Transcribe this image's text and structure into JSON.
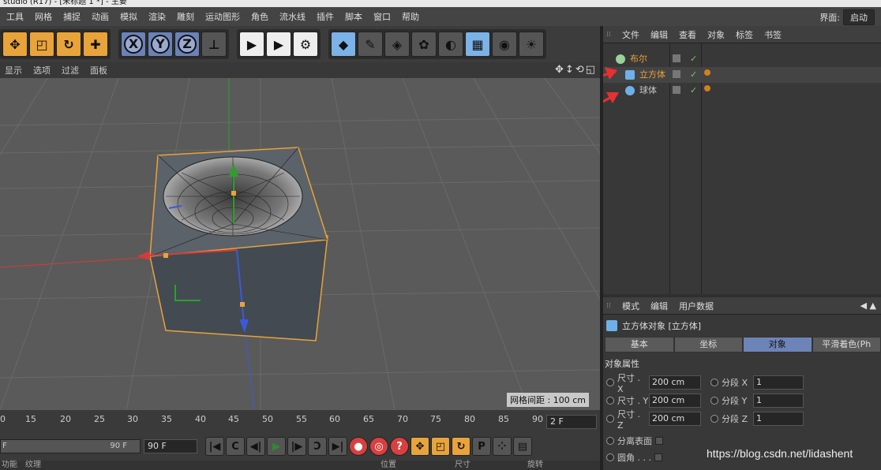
{
  "window": {
    "title": "studio (R17) - [未标题 1 *] - 主要"
  },
  "menubar": {
    "items": [
      "工具",
      "网格",
      "捕捉",
      "动画",
      "模拟",
      "渲染",
      "雕刻",
      "运动图形",
      "角色",
      "流水线",
      "插件",
      "脚本",
      "窗口",
      "帮助"
    ],
    "layout_label": "界面:",
    "layout_value": "启动"
  },
  "viewport": {
    "menu": [
      "显示",
      "选项",
      "过滤",
      "面板"
    ],
    "grid_spacing": "网格间距 : 100 cm"
  },
  "timeline": {
    "ticks": [
      "0",
      "15",
      "20",
      "25",
      "30",
      "35",
      "40",
      "45",
      "50",
      "55",
      "60",
      "65",
      "70",
      "75",
      "80",
      "85",
      "90"
    ],
    "current_frame": "2 F"
  },
  "transport": {
    "slider_start": "F",
    "slider_end": "90 F",
    "end_field": "90 F"
  },
  "bottom": {
    "labels": [
      "功能",
      "纹理",
      "位置",
      "尺寸",
      "旋转"
    ]
  },
  "object_manager": {
    "menu": [
      "文件",
      "编辑",
      "查看",
      "对象",
      "标签",
      "书签"
    ],
    "objects": [
      {
        "name": "布尔",
        "color": "#e8a33a"
      },
      {
        "name": "立方体",
        "color": "#e8a33a"
      },
      {
        "name": "球体",
        "color": "#c8c8c8"
      }
    ]
  },
  "attributes": {
    "menu": [
      "模式",
      "编辑",
      "用户数据"
    ],
    "object_title": "立方体对象 [立方体]",
    "tabs": [
      "基本",
      "坐标",
      "对象",
      "平滑着色(Ph"
    ],
    "active_tab": "对象",
    "section": "对象属性",
    "size_labels": [
      "尺寸 . X",
      "尺寸 . Y",
      "尺寸 . Z"
    ],
    "size_values": [
      "200 cm",
      "200 cm",
      "200 cm"
    ],
    "segment_labels": [
      "分段 X",
      "分段 Y",
      "分段 Z"
    ],
    "segment_values": [
      "1",
      "1",
      "1"
    ],
    "separate_surfaces": "分离表面",
    "fillet": "圆角 . . ."
  },
  "watermark": "https://blog.csdn.net/lidashent"
}
